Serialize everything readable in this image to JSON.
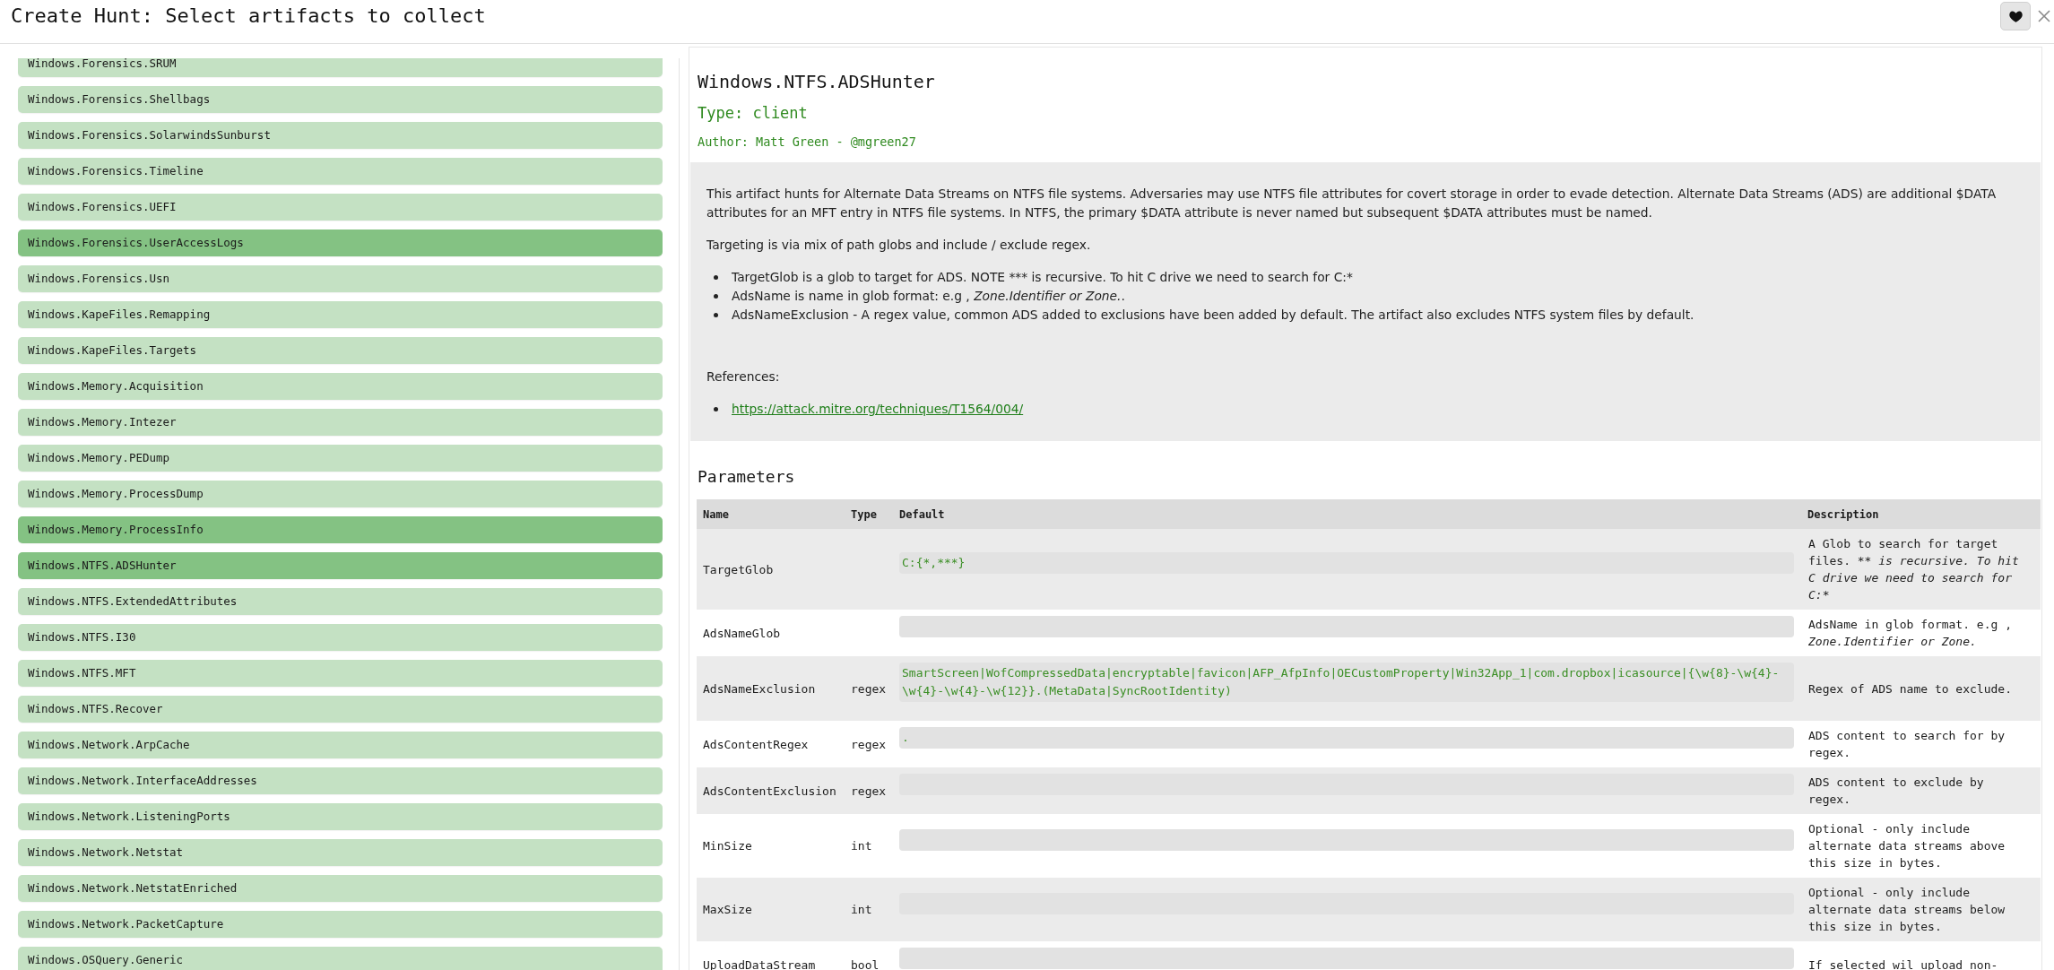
{
  "header": {
    "title": "Create Hunt: Select artifacts to collect"
  },
  "artifact_list": {
    "items": [
      {
        "name": "Windows.Forensics.SRUM",
        "selected": false
      },
      {
        "name": "Windows.Forensics.Shellbags",
        "selected": false
      },
      {
        "name": "Windows.Forensics.SolarwindsSunburst",
        "selected": false
      },
      {
        "name": "Windows.Forensics.Timeline",
        "selected": false
      },
      {
        "name": "Windows.Forensics.UEFI",
        "selected": false
      },
      {
        "name": "Windows.Forensics.UserAccessLogs",
        "selected": true
      },
      {
        "name": "Windows.Forensics.Usn",
        "selected": false
      },
      {
        "name": "Windows.KapeFiles.Remapping",
        "selected": false
      },
      {
        "name": "Windows.KapeFiles.Targets",
        "selected": false
      },
      {
        "name": "Windows.Memory.Acquisition",
        "selected": false
      },
      {
        "name": "Windows.Memory.Intezer",
        "selected": false
      },
      {
        "name": "Windows.Memory.PEDump",
        "selected": false
      },
      {
        "name": "Windows.Memory.ProcessDump",
        "selected": false
      },
      {
        "name": "Windows.Memory.ProcessInfo",
        "selected": true
      },
      {
        "name": "Windows.NTFS.ADSHunter",
        "selected": true
      },
      {
        "name": "Windows.NTFS.ExtendedAttributes",
        "selected": false
      },
      {
        "name": "Windows.NTFS.I30",
        "selected": false
      },
      {
        "name": "Windows.NTFS.MFT",
        "selected": false
      },
      {
        "name": "Windows.NTFS.Recover",
        "selected": false
      },
      {
        "name": "Windows.Network.ArpCache",
        "selected": false
      },
      {
        "name": "Windows.Network.InterfaceAddresses",
        "selected": false
      },
      {
        "name": "Windows.Network.ListeningPorts",
        "selected": false
      },
      {
        "name": "Windows.Network.Netstat",
        "selected": false
      },
      {
        "name": "Windows.Network.NetstatEnriched",
        "selected": false
      },
      {
        "name": "Windows.Network.PacketCapture",
        "selected": false
      },
      {
        "name": "Windows.OSQuery.Generic",
        "selected": false
      }
    ]
  },
  "artifact": {
    "name": "Windows.NTFS.ADSHunter",
    "type": "Type: client",
    "author": "Author: Matt Green - @mgreen27",
    "description": {
      "paragraphs": [
        "This artifact hunts for Alternate Data Streams on NTFS file systems. Adversaries may use NTFS file attributes for covert storage in order to evade detection. Alternate Data Streams (ADS) are additional $DATA attributes for an MFT entry in NTFS file systems. In NTFS, the primary $DATA attribute is never named but subsequent $DATA attributes must be named.",
        "Targeting is via mix of path globs and include / exclude regex."
      ],
      "bullets": [
        [
          {
            "text": "TargetGlob is a glob to target for ADS. NOTE *** is recursive. To hit C drive we need to search for C:*",
            "italic": false
          }
        ],
        [
          {
            "text": "AdsName is name in glob format: e.g , ",
            "italic": false
          },
          {
            "text": "Zone.Identifier or Zone.",
            "italic": true
          },
          {
            "text": ".",
            "italic": false
          }
        ],
        [
          {
            "text": "AdsNameExclusion - A regex value, common ADS added to exclusions have been added by default. The artifact also excludes NTFS system files by default.",
            "italic": false
          }
        ]
      ],
      "references_label": "References:",
      "references": [
        "https://attack.mitre.org/techniques/T1564/004/"
      ]
    }
  },
  "parameters": {
    "title": "Parameters",
    "columns": [
      "Name",
      "Type",
      "Default",
      "Description"
    ],
    "rows": [
      {
        "name": "TargetGlob",
        "default": "C:{*,***}",
        "description": [
          {
            "text": "A Glob to search for target files. ** ",
            "italic": false
          },
          {
            "text": "is recursive. To hit C drive we need to search for C:*",
            "italic": true
          }
        ]
      },
      {
        "name": "AdsNameGlob",
        "description": [
          {
            "text": "AdsName in glob format. e.g , ",
            "italic": false
          },
          {
            "text": "Zone.Identifier or Zone.",
            "italic": true
          }
        ]
      },
      {
        "name": "AdsNameExclusion",
        "type": "regex",
        "default": "SmartScreen|WofCompressedData|encryptable|favicon|AFP_AfpInfo|OECustomProperty|Win32App_1|com.dropbox|icasource|{\\w{8}-\\w{4}-\\w{4}-\\w{4}-\\w{12}}.(MetaData|SyncRootIdentity)",
        "description": [
          {
            "text": "Regex of ADS name to exclude.",
            "italic": false
          }
        ]
      },
      {
        "name": "AdsContentRegex",
        "type": "regex",
        "default": ".",
        "description": [
          {
            "text": "ADS content to search for by regex.",
            "italic": false
          }
        ]
      },
      {
        "name": "AdsContentExclusion",
        "type": "regex",
        "description": [
          {
            "text": "ADS content to exclude by regex.",
            "italic": false
          }
        ]
      },
      {
        "name": "MinSize",
        "type": "int",
        "description": [
          {
            "text": "Optional - only include alternate data streams above this size in bytes.",
            "italic": false
          }
        ]
      },
      {
        "name": "MaxSize",
        "type": "int",
        "description": [
          {
            "text": "Optional - only include alternate data streams below this size in bytes.",
            "italic": false
          }
        ]
      },
      {
        "name": "UploadDataStream",
        "type": "bool",
        "description": [
          {
            "text": "If selected wil upload non-",
            "italic": false
          }
        ]
      }
    ]
  }
}
